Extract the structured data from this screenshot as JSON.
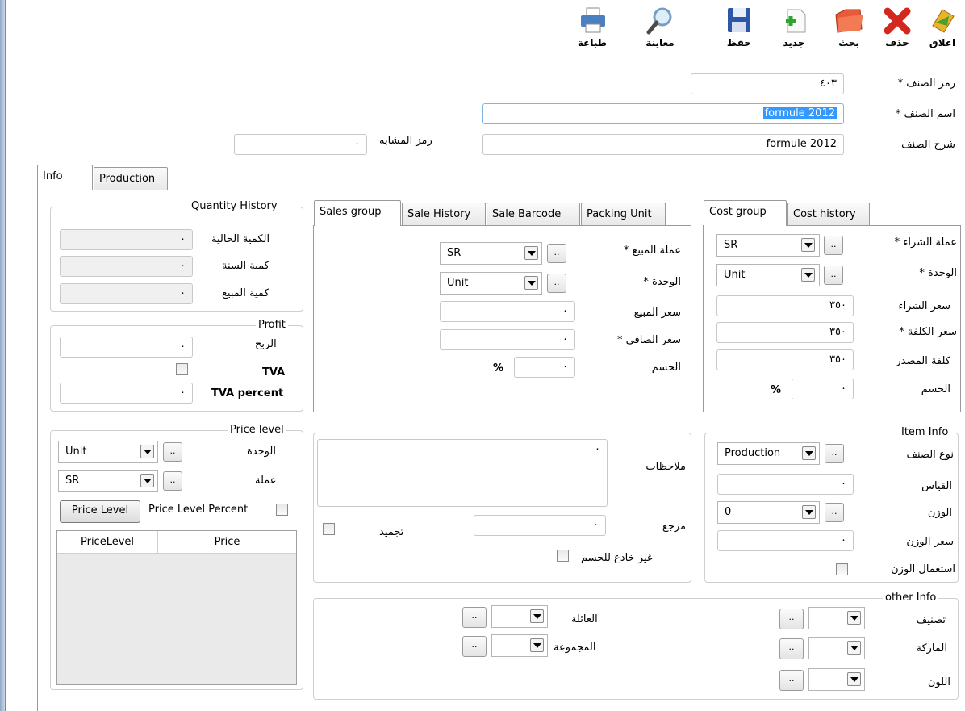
{
  "toolbar": {
    "close": "اغلاق",
    "delete": "حذف",
    "search": "بحث",
    "new": "جديد",
    "save": "حفظ",
    "preview": "معاينة",
    "print": "طباعة"
  },
  "header": {
    "code_label": "رمز الصنف *",
    "code_value": "٤٠٣",
    "name_label": "اسم الصنف *",
    "name_value": "formule 2012",
    "desc_label": "شرح الصنف",
    "desc_value": "formule 2012",
    "similar_label": "رمز المشابه",
    "similar_value": "٠"
  },
  "main_tabs": [
    "Info",
    "Production"
  ],
  "quantity_history": {
    "title": "Quantity History",
    "current_label": "الكمية الحالية",
    "current_value": "٠",
    "year_label": "كمية السنة",
    "year_value": "٠",
    "sold_label": "كمية المبيع",
    "sold_value": "٠"
  },
  "profit": {
    "title": "Profit",
    "profit_label": "الربح",
    "profit_value": "٠",
    "tva_label": "TVA",
    "tva_percent_label": "TVA percent",
    "tva_percent_value": "٠"
  },
  "price_level": {
    "title": "Price level",
    "unit_label": "الوحدة",
    "unit_value": "Unit",
    "currency_label": "عملة",
    "currency_value": "SR",
    "button": "Price Level",
    "percent_label": "Price Level Percent",
    "grid_headers": [
      "PriceLevel",
      "Price"
    ]
  },
  "sales_tabs": [
    "Sales group",
    "Sale History",
    "Sale Barcode",
    "Packing Unit"
  ],
  "sales": {
    "currency_label": "عملة المبيع *",
    "currency_value": "SR",
    "unit_label": "الوحدة *",
    "unit_value": "Unit",
    "price_label": "سعر المبيع",
    "price_value": "٠",
    "net_label": "سعر الصافي *",
    "net_value": "٠",
    "discount_label": "الحسم",
    "discount_value": "٠",
    "percent": "%"
  },
  "cost_tabs": [
    "Cost group",
    "Cost history"
  ],
  "cost": {
    "currency_label": "عملة الشراء *",
    "currency_value": "SR",
    "unit_label": "الوحدة *",
    "unit_value": "Unit",
    "buy_label": "سعر الشراء",
    "buy_value": "٣٥٠",
    "cost_label": "سعر الكلفة *",
    "cost_value": "٣٥٠",
    "source_label": "كلفة المصدر",
    "source_value": "٣٥٠",
    "discount_label": "الحسم",
    "discount_value": "٠",
    "percent": "%"
  },
  "notes": {
    "notes_label": "ملاحظات",
    "notes_value": "٠",
    "ref_label": "مرجع",
    "ref_value": "٠",
    "freeze_label": "تجميد",
    "nodiscount_label": "غير خادع للحسم"
  },
  "item_info": {
    "title": "Item Info",
    "type_label": "نوع الصنف",
    "type_value": "Production",
    "size_label": "القياس",
    "size_value": "٠",
    "weight_label": "الوزن",
    "weight_value": "0",
    "weight_price_label": "سعر الوزن",
    "weight_price_value": "٠",
    "use_weight_label": "استعمال الوزن"
  },
  "other_info": {
    "title": "other Info",
    "category_label": "تصنيف",
    "brand_label": "الماركة",
    "color_label": "اللون",
    "family_label": "العائلة",
    "group_label": "المجموعة"
  },
  "ellipsis": ".."
}
